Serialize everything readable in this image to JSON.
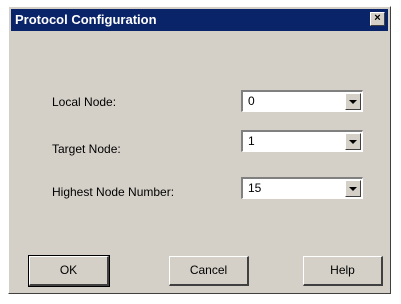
{
  "window": {
    "title": "Protocol Configuration",
    "close_glyph": "×"
  },
  "fields": [
    {
      "label": "Local Node:",
      "value": "0"
    },
    {
      "label": "Target Node:",
      "value": "1"
    },
    {
      "label": "Highest Node Number:",
      "value": "15"
    }
  ],
  "buttons": {
    "ok_label": "OK",
    "cancel_label": "Cancel",
    "help_label": "Help"
  },
  "icons": {
    "close": "close-icon",
    "dropdown": "chevron-down-icon"
  }
}
